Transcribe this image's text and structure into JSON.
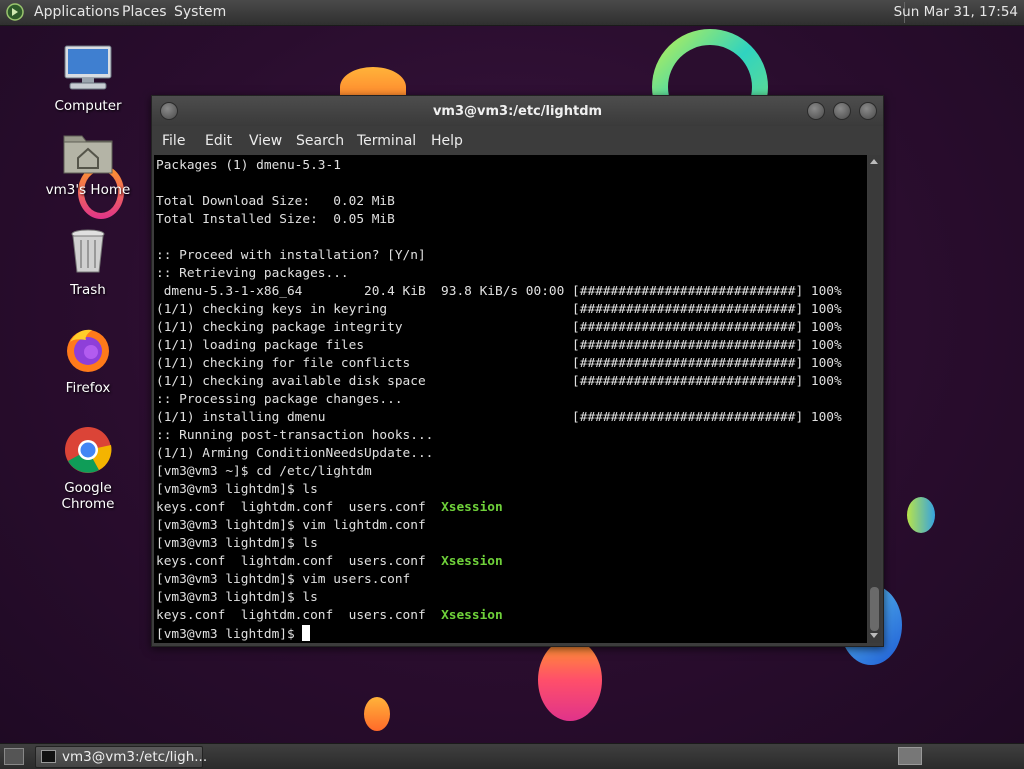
{
  "top_panel": {
    "menu_applications": "Applications",
    "menu_places": "Places",
    "menu_system": "System",
    "clock": "Sun Mar 31, 17:54"
  },
  "desktop_icons": {
    "computer": "Computer",
    "home": "vm3's Home",
    "trash": "Trash",
    "firefox": "Firefox",
    "chrome": "Google Chrome"
  },
  "terminal": {
    "title": "vm3@vm3:/etc/lightdm",
    "menu": [
      "File",
      "Edit",
      "View",
      "Search",
      "Terminal",
      "Help"
    ],
    "lines": [
      {
        "text": "Packages (1) dmenu-5.3-1"
      },
      {
        "text": ""
      },
      {
        "text": "Total Download Size:   0.02 MiB"
      },
      {
        "text": "Total Installed Size:  0.05 MiB"
      },
      {
        "text": ""
      },
      {
        "text": ":: Proceed with installation? [Y/n]"
      },
      {
        "text": ":: Retrieving packages..."
      },
      {
        "text": " dmenu-5.3-1-x86_64        20.4 KiB  93.8 KiB/s 00:00 [############################] 100%"
      },
      {
        "text": "(1/1) checking keys in keyring                        [############################] 100%"
      },
      {
        "text": "(1/1) checking package integrity                      [############################] 100%"
      },
      {
        "text": "(1/1) loading package files                           [############################] 100%"
      },
      {
        "text": "(1/1) checking for file conflicts                     [############################] 100%"
      },
      {
        "text": "(1/1) checking available disk space                   [############################] 100%"
      },
      {
        "text": ":: Processing package changes..."
      },
      {
        "text": "(1/1) installing dmenu                                [############################] 100%"
      },
      {
        "text": ":: Running post-transaction hooks..."
      },
      {
        "text": "(1/1) Arming ConditionNeedsUpdate..."
      },
      {
        "text": "[vm3@vm3 ~]$ cd /etc/lightdm"
      },
      {
        "text": "[vm3@vm3 lightdm]$ ls"
      },
      {
        "text": "keys.conf  lightdm.conf  users.conf  ",
        "highlight": "Xsession"
      },
      {
        "text": "[vm3@vm3 lightdm]$ vim lightdm.conf"
      },
      {
        "text": "[vm3@vm3 lightdm]$ ls"
      },
      {
        "text": "keys.conf  lightdm.conf  users.conf  ",
        "highlight": "Xsession"
      },
      {
        "text": "[vm3@vm3 lightdm]$ vim users.conf"
      },
      {
        "text": "[vm3@vm3 lightdm]$ ls"
      },
      {
        "text": "keys.conf  lightdm.conf  users.conf  ",
        "highlight": "Xsession"
      },
      {
        "text": "[vm3@vm3 lightdm]$ ",
        "cursor": true
      }
    ]
  },
  "taskbar": {
    "task_label": "vm3@vm3:/etc/ligh..."
  },
  "colors": {
    "terminal_bg": "#000000",
    "terminal_fg": "#e0e0e0",
    "executable_highlight": "#6fd13a"
  }
}
